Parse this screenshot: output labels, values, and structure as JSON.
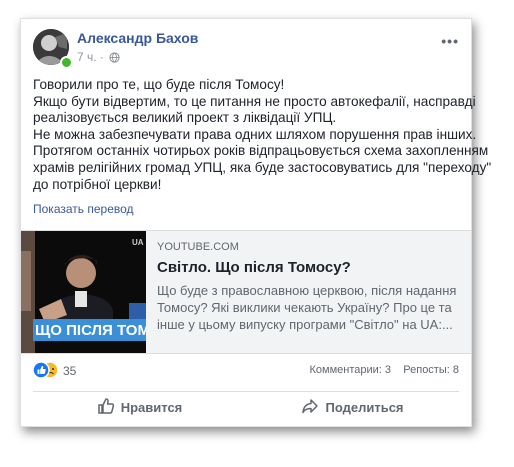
{
  "post": {
    "author": "Александр Бахов",
    "time": "7 ч. ·",
    "text_lines": [
      "Говорили про те, що буде після Томосу!",
      "Якщо бути відвертим, то це питання не просто автокефалії, насправді",
      "реалізовується великий проект з ліквідації УПЦ.",
      "Не можна забезпечувати права одних шляхом порушення прав інших.",
      "Протягом останніх чотирьох років відпрацьовується схема захопленням",
      "храмів релігійних громад УПЦ, яка буде застосовуватись для \"переходу\"",
      "до потрібної церкви!"
    ],
    "translate_label": "Показать перевод"
  },
  "link": {
    "domain": "YOUTUBE.COM",
    "title": "Світло. Що після Томосу?",
    "desc_lines": [
      "Що буде з православною церквою, після надання",
      "Томосу? Які виклики чекають Україну? Про це та",
      "інше у цьому випуску програми \"Світло\" на UA:..."
    ],
    "thumb_caption": "ЩО ПІСЛЯ ТОМ",
    "thumb_logo": "UA"
  },
  "stats": {
    "reaction_count": "35",
    "comments": "Комментарии: 3",
    "reposts": "Репосты: 8"
  },
  "actions": {
    "like": "Нравится",
    "share": "Поделиться"
  },
  "colors": {
    "link_blue": "#385898",
    "like_blue": "#1877f2",
    "sad_yellow": "#f7b928",
    "online_green": "#42b72a"
  }
}
